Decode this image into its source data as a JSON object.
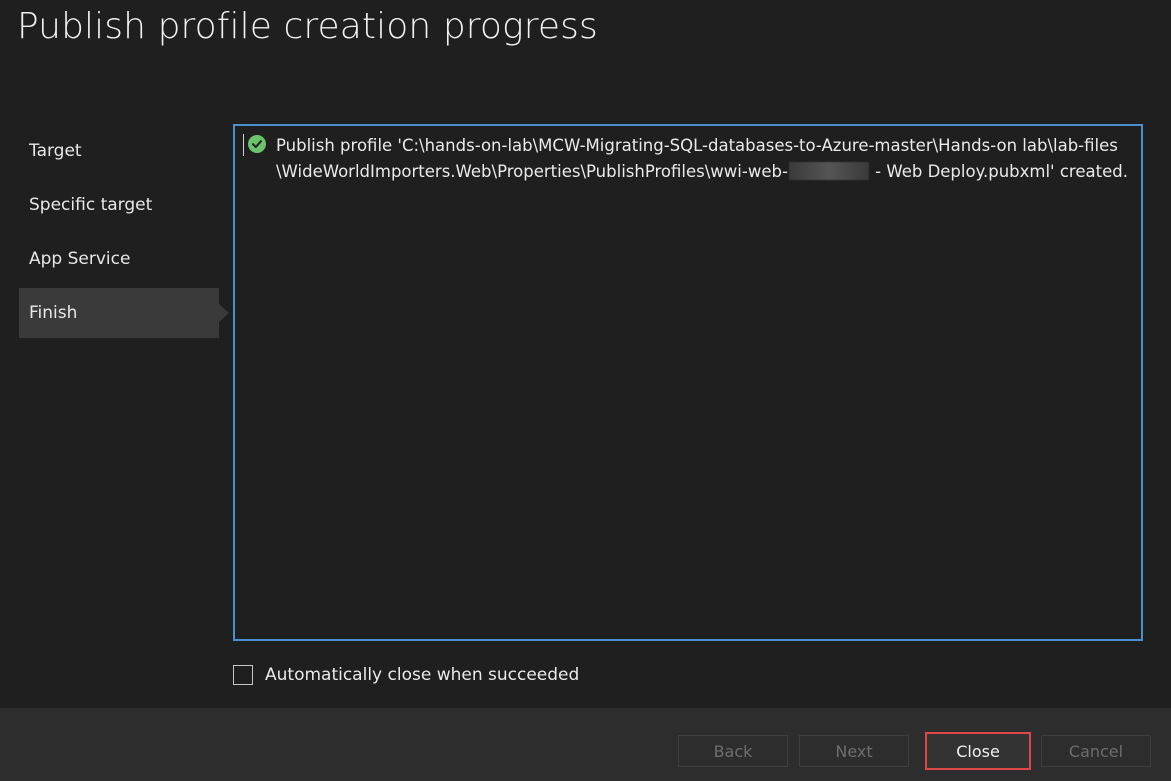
{
  "window": {
    "title": "Publish profile creation progress"
  },
  "steps": [
    {
      "label": "Target",
      "active": false
    },
    {
      "label": "Specific target",
      "active": false
    },
    {
      "label": "App Service",
      "active": false
    },
    {
      "label": "Finish",
      "active": true
    }
  ],
  "output": {
    "status_icon": "check-circle-icon",
    "status_color": "#6bc36b",
    "line1": "Publish profile 'C:\\hands-on-lab\\MCW-Migrating-SQL-databases-to-Azure-master\\Hands-on lab\\lab-files",
    "line2_prefix": "\\WideWorldImporters.Web\\Properties\\PublishProfiles\\wwi-web-",
    "line2_suffix": " - Web Deploy.pubxml' created."
  },
  "options": {
    "auto_close_label": "Automatically close when succeeded",
    "auto_close_checked": false
  },
  "footer": {
    "back_label": "Back",
    "next_label": "Next",
    "close_label": "Close",
    "cancel_label": "Cancel"
  },
  "colors": {
    "accent_border": "#4a8fd0",
    "highlight_border": "#e04848"
  }
}
